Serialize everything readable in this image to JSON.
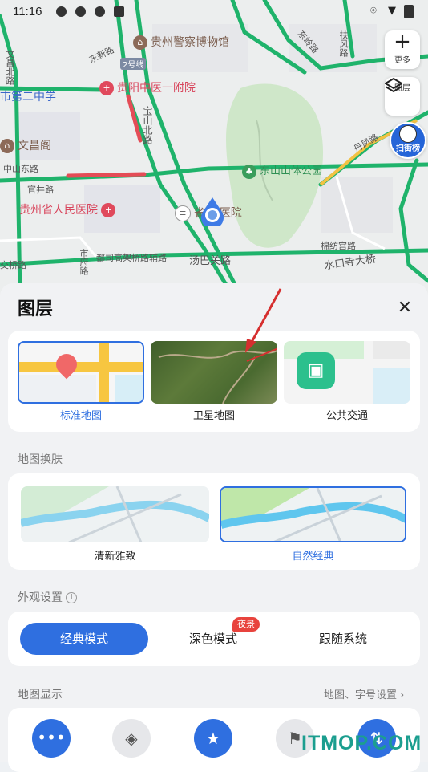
{
  "status": {
    "time": "11:16"
  },
  "map": {
    "labels": {
      "police_museum": "贵州警察博物馆",
      "tcm_hospital": "贵阳中医一附院",
      "no2_school": "市第二中学",
      "wenchang": "文昌阁",
      "zhongshan_rd": "中山东路",
      "dongxin_rd": "东新路",
      "baoshan_rd": "宝山北路",
      "guansheng": "官井路",
      "prov_hospital": "贵州省人民医院",
      "sheng_hospital": "省",
      "hospital_suffix": "医院",
      "dongshan_park": "东山山体公园",
      "tangba_rd": "汤巴关路",
      "shuikou_rd": "水口寺大桥",
      "dushi_rd": "都司高架桥路辅路",
      "fuqian": "扶风路",
      "dongling": "东岭路",
      "wenchang_n": "文昌北路",
      "gongxiao": "棉纺宫路",
      "danfeng": "丹凤路",
      "shiliqiao": "市府路",
      "jiaoxi": "交桥路",
      "line2": "2号线"
    },
    "more_btn": "更多",
    "layers_btn": "图层",
    "scan_btn": "扫街榜"
  },
  "sheet": {
    "title": "图层",
    "map_types": [
      {
        "label": "标准地图",
        "selected": true
      },
      {
        "label": "卫星地图",
        "selected": false
      },
      {
        "label": "公共交通",
        "selected": false
      }
    ],
    "skin_title": "地图换肤",
    "skins": [
      {
        "label": "清新雅致",
        "selected": false
      },
      {
        "label": "自然经典",
        "selected": true
      }
    ],
    "appearance_title": "外观设置",
    "modes": [
      {
        "label": "经典模式",
        "selected": true
      },
      {
        "label": "深色模式",
        "selected": false,
        "badge": "夜景"
      },
      {
        "label": "跟随系统",
        "selected": false
      }
    ],
    "display_title": "地图显示",
    "display_link": "地图、字号设置"
  },
  "watermark": "ITMOP.COM",
  "colors": {
    "accent": "#2f6fe0",
    "traffic_green": "#1fb36b",
    "traffic_red": "#e44c56",
    "badge": "#e8433d"
  }
}
